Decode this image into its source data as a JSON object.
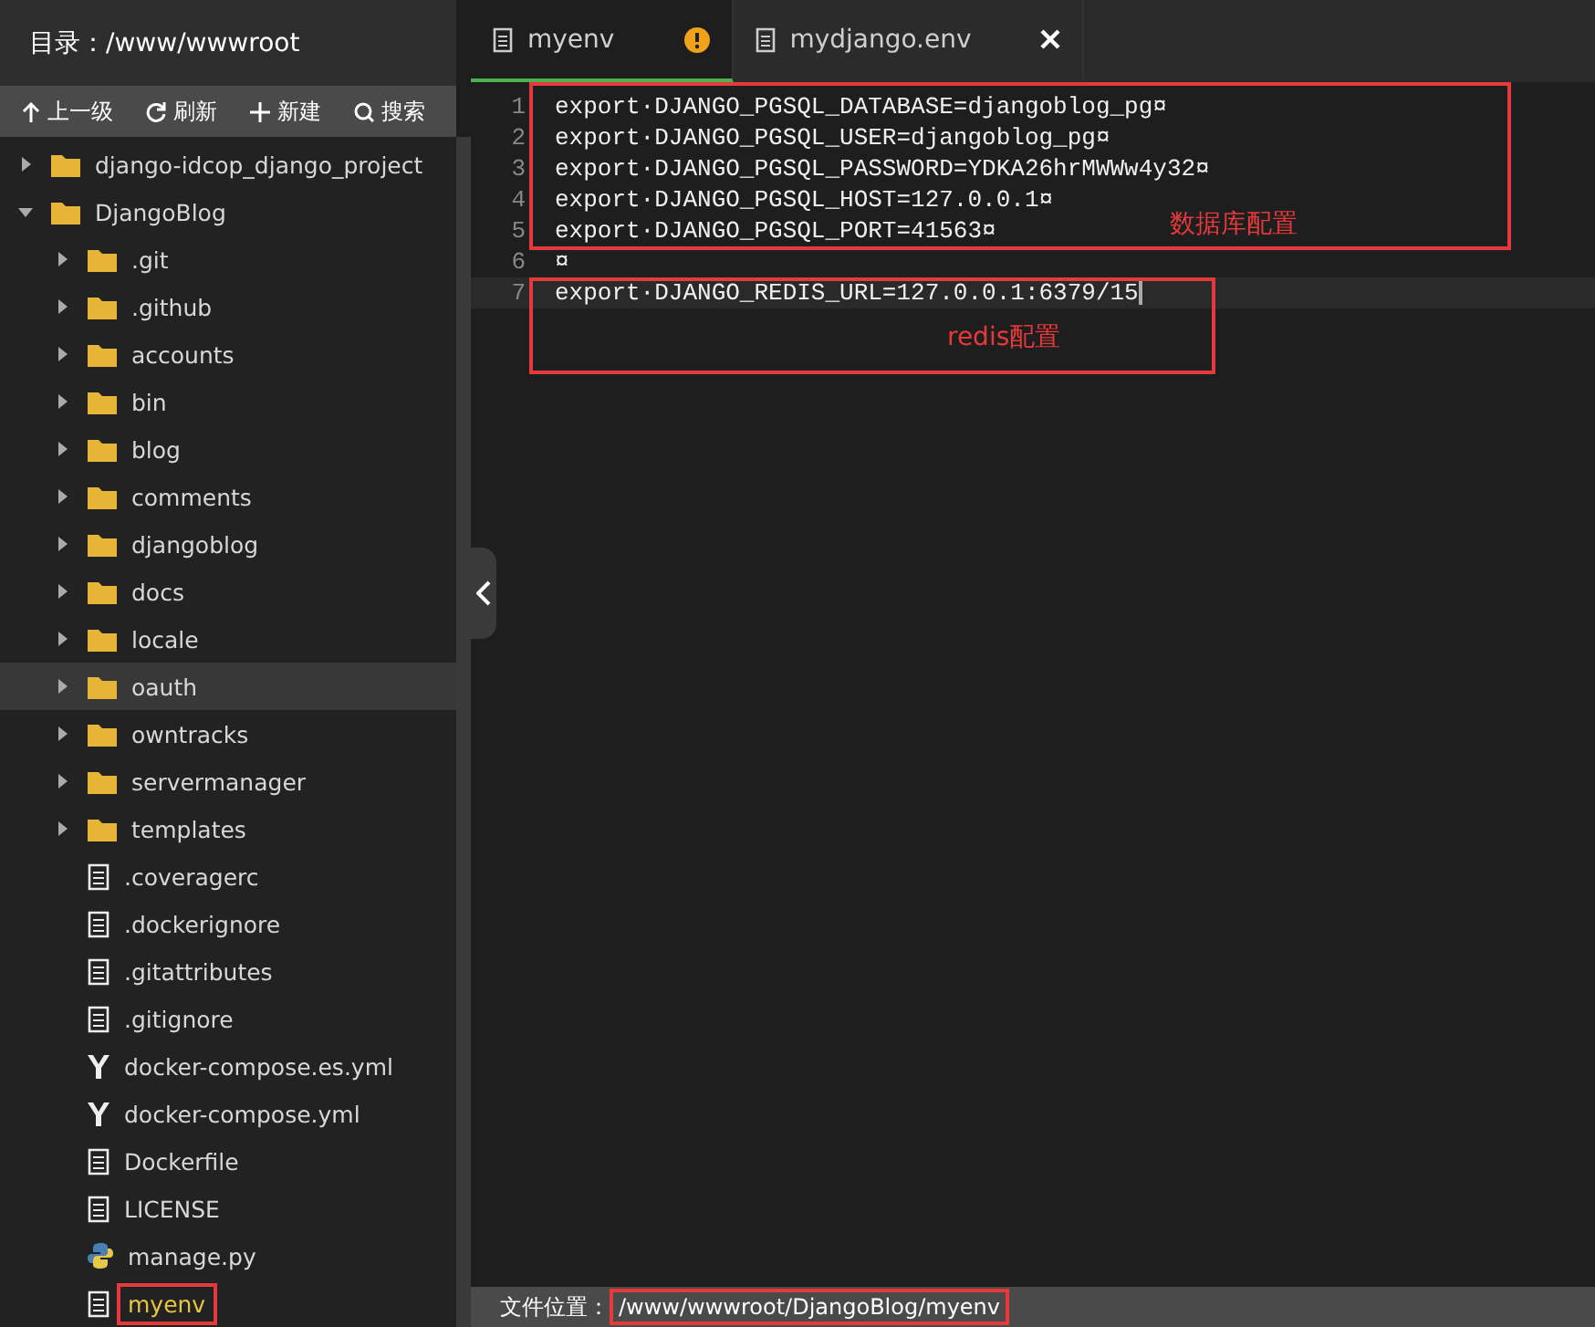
{
  "sidebar": {
    "title": "目录：/www/wwwroot",
    "toolbar": [
      {
        "kind": "up",
        "label": "上一级"
      },
      {
        "kind": "refresh",
        "label": "刷新"
      },
      {
        "kind": "new",
        "label": "新建"
      },
      {
        "kind": "search",
        "label": "搜索"
      }
    ],
    "tree": [
      {
        "kind": "folder",
        "name": "django-idcop_django_project",
        "expanded": false,
        "selected": false,
        "current": false
      },
      {
        "kind": "folder",
        "name": "DjangoBlog",
        "expanded": true,
        "selected": false,
        "current": false,
        "children": [
          {
            "kind": "folder",
            "name": ".git",
            "expanded": false,
            "selected": false,
            "current": false
          },
          {
            "kind": "folder",
            "name": ".github",
            "expanded": false,
            "selected": false,
            "current": false
          },
          {
            "kind": "folder",
            "name": "accounts",
            "expanded": false,
            "selected": false,
            "current": false
          },
          {
            "kind": "folder",
            "name": "bin",
            "expanded": false,
            "selected": false,
            "current": false
          },
          {
            "kind": "folder",
            "name": "blog",
            "expanded": false,
            "selected": false,
            "current": false
          },
          {
            "kind": "folder",
            "name": "comments",
            "expanded": false,
            "selected": false,
            "current": false
          },
          {
            "kind": "folder",
            "name": "djangoblog",
            "expanded": false,
            "selected": false,
            "current": false
          },
          {
            "kind": "folder",
            "name": "docs",
            "expanded": false,
            "selected": false,
            "current": false
          },
          {
            "kind": "folder",
            "name": "locale",
            "expanded": false,
            "selected": false,
            "current": false
          },
          {
            "kind": "folder",
            "name": "oauth",
            "expanded": false,
            "selected": true,
            "current": false
          },
          {
            "kind": "folder",
            "name": "owntracks",
            "expanded": false,
            "selected": false,
            "current": false
          },
          {
            "kind": "folder",
            "name": "servermanager",
            "expanded": false,
            "selected": false,
            "current": false
          },
          {
            "kind": "folder",
            "name": "templates",
            "expanded": false,
            "selected": false,
            "current": false
          },
          {
            "kind": "file",
            "name": ".coveragerc",
            "selected": false,
            "current": false
          },
          {
            "kind": "file",
            "name": ".dockerignore",
            "selected": false,
            "current": false
          },
          {
            "kind": "file",
            "name": ".gitattributes",
            "selected": false,
            "current": false
          },
          {
            "kind": "file",
            "name": ".gitignore",
            "selected": false,
            "current": false
          },
          {
            "kind": "yaml",
            "name": "docker-compose.es.yml",
            "selected": false,
            "current": false
          },
          {
            "kind": "yaml",
            "name": "docker-compose.yml",
            "selected": false,
            "current": false
          },
          {
            "kind": "file",
            "name": "Dockerfile",
            "selected": false,
            "current": false
          },
          {
            "kind": "file",
            "name": "LICENSE",
            "selected": false,
            "current": false
          },
          {
            "kind": "python",
            "name": "manage.py",
            "selected": false,
            "current": false
          },
          {
            "kind": "file",
            "name": "myenv",
            "selected": false,
            "current": true
          }
        ]
      }
    ]
  },
  "tabs": [
    {
      "label": "myenv",
      "selected": true,
      "modified": true,
      "closable": false
    },
    {
      "label": "mydjango.env",
      "selected": false,
      "modified": false,
      "closable": true
    }
  ],
  "editor": {
    "lines": [
      {
        "number": "1",
        "code": "export·DJANGO_PGSQL_DATABASE=djangoblog_pg¤",
        "current": false
      },
      {
        "number": "2",
        "code": "export·DJANGO_PGSQL_USER=djangoblog_pg¤",
        "current": false
      },
      {
        "number": "3",
        "code": "export·DJANGO_PGSQL_PASSWORD=YDKA26hrMWWw4y32¤",
        "current": false
      },
      {
        "number": "4",
        "code": "export·DJANGO_PGSQL_HOST=127.0.0.1¤",
        "current": false
      },
      {
        "number": "5",
        "code": "export·DJANGO_PGSQL_PORT=41563¤",
        "current": false
      },
      {
        "number": "6",
        "code": "¤",
        "current": false
      },
      {
        "number": "7",
        "code": "export·DJANGO_REDIS_URL=127.0.0.1:6379/15",
        "current": true
      }
    ],
    "annotations": [
      {
        "label": "数据库配置"
      },
      {
        "label": "redis配置"
      }
    ]
  },
  "status_bar": {
    "label": "文件位置：",
    "path": "/www/wwwroot/DjangoBlog/myenv"
  }
}
